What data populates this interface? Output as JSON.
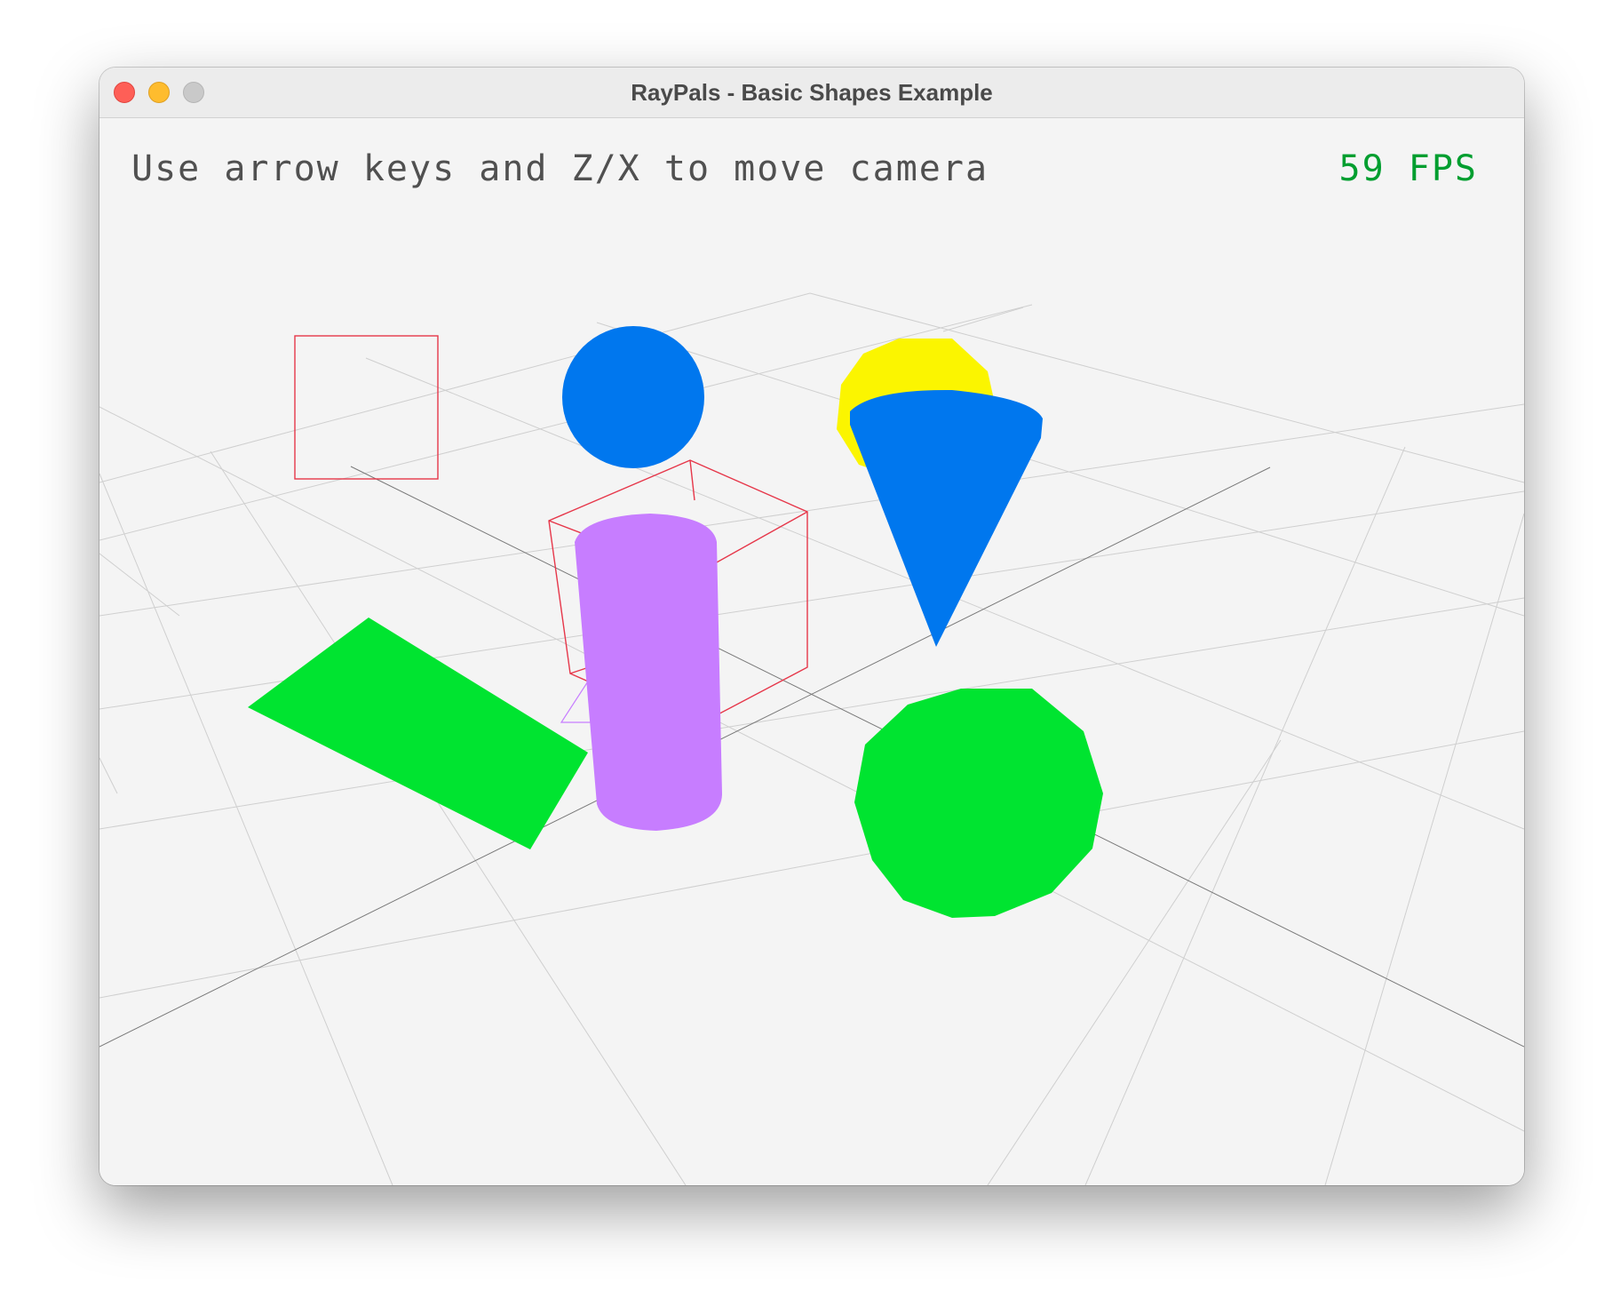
{
  "window": {
    "title": "RayPals - Basic Shapes Example"
  },
  "hud": {
    "help_text": "Use arrow keys and Z/X to move camera",
    "fps_text": "59 FPS"
  },
  "colors": {
    "background": "#f4f4f4",
    "grid_line": "#c8c8c8",
    "grid_axis": "#6e6e6e",
    "wire_red": "#e6374a",
    "blue": "#0077ee",
    "yellow": "#fbf500",
    "green": "#00e430",
    "purple": "#c77dff",
    "fps_green": "#009e2f"
  },
  "scene": {
    "objects": [
      "wire-square",
      "blue-circle",
      "yellow-sphere",
      "blue-cone",
      "wire-cube",
      "green-rectangle",
      "purple-cylinder",
      "green-sphere"
    ]
  }
}
